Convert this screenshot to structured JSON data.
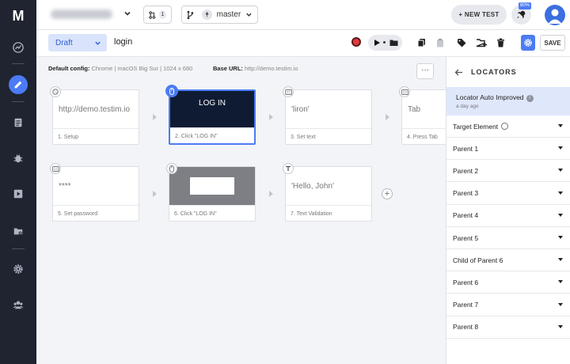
{
  "rail": {
    "logo": "M",
    "items": [
      {
        "name": "dashboard",
        "icon": "trend-icon"
      },
      {
        "name": "editor",
        "icon": "pencil-icon",
        "active": true
      },
      {
        "name": "tests",
        "icon": "list-icon"
      },
      {
        "name": "bugs",
        "icon": "bug-icon"
      },
      {
        "name": "runs",
        "icon": "play-icon"
      },
      {
        "name": "files",
        "icon": "folder-gear-icon"
      },
      {
        "name": "settings",
        "icon": "gear-icon"
      },
      {
        "name": "team",
        "icon": "users-icon"
      }
    ]
  },
  "topbar": {
    "pr_count": "1",
    "branch": "master",
    "new_test_label": "+ NEW TEST",
    "rocket_badge": "80%"
  },
  "toolbar": {
    "status": "Draft",
    "test_name": "login",
    "save_label": "SAVE"
  },
  "canvas": {
    "config_label": "Default config:",
    "config_value": "Chrome | macOS Big Sur | 1024 x 680",
    "base_label": "Base URL:",
    "base_value": "http://demo.testim.io",
    "more_label": "···",
    "steps": [
      {
        "body": "http://demo.testim.io",
        "label": "1. Setup",
        "icon": "cookie-icon"
      },
      {
        "body": "LOG IN",
        "label": "2. Click \"LOG IN\"",
        "icon": "mouse-icon",
        "selected": true
      },
      {
        "body": "'liron'",
        "label": "3. Set text",
        "icon": "keyboard-icon"
      },
      {
        "body": "Tab",
        "label": "4. Press Tab",
        "icon": "keyboard-icon"
      },
      {
        "body": "****",
        "label": "5. Set password",
        "icon": "keyboard-icon"
      },
      {
        "body": "",
        "label": "6. Click \"LOG IN\"",
        "icon": "mouse-icon"
      },
      {
        "body": "'Hello, John'",
        "label": "7. Text Validation",
        "icon": "text-icon"
      }
    ]
  },
  "panel": {
    "title": "LOCATORS",
    "notice_title": "Locator Auto Improved",
    "notice_time": "a day ago",
    "rows": [
      "Target Element",
      "Parent 1",
      "Parent 2",
      "Parent 3",
      "Parent 4",
      "Parent 5",
      "Child of Parent 6",
      "Parent 6",
      "Parent 7",
      "Parent 8"
    ]
  },
  "colors": {
    "accent": "#4b7bf5",
    "rail": "#1f2430",
    "record": "#e03b3b"
  }
}
